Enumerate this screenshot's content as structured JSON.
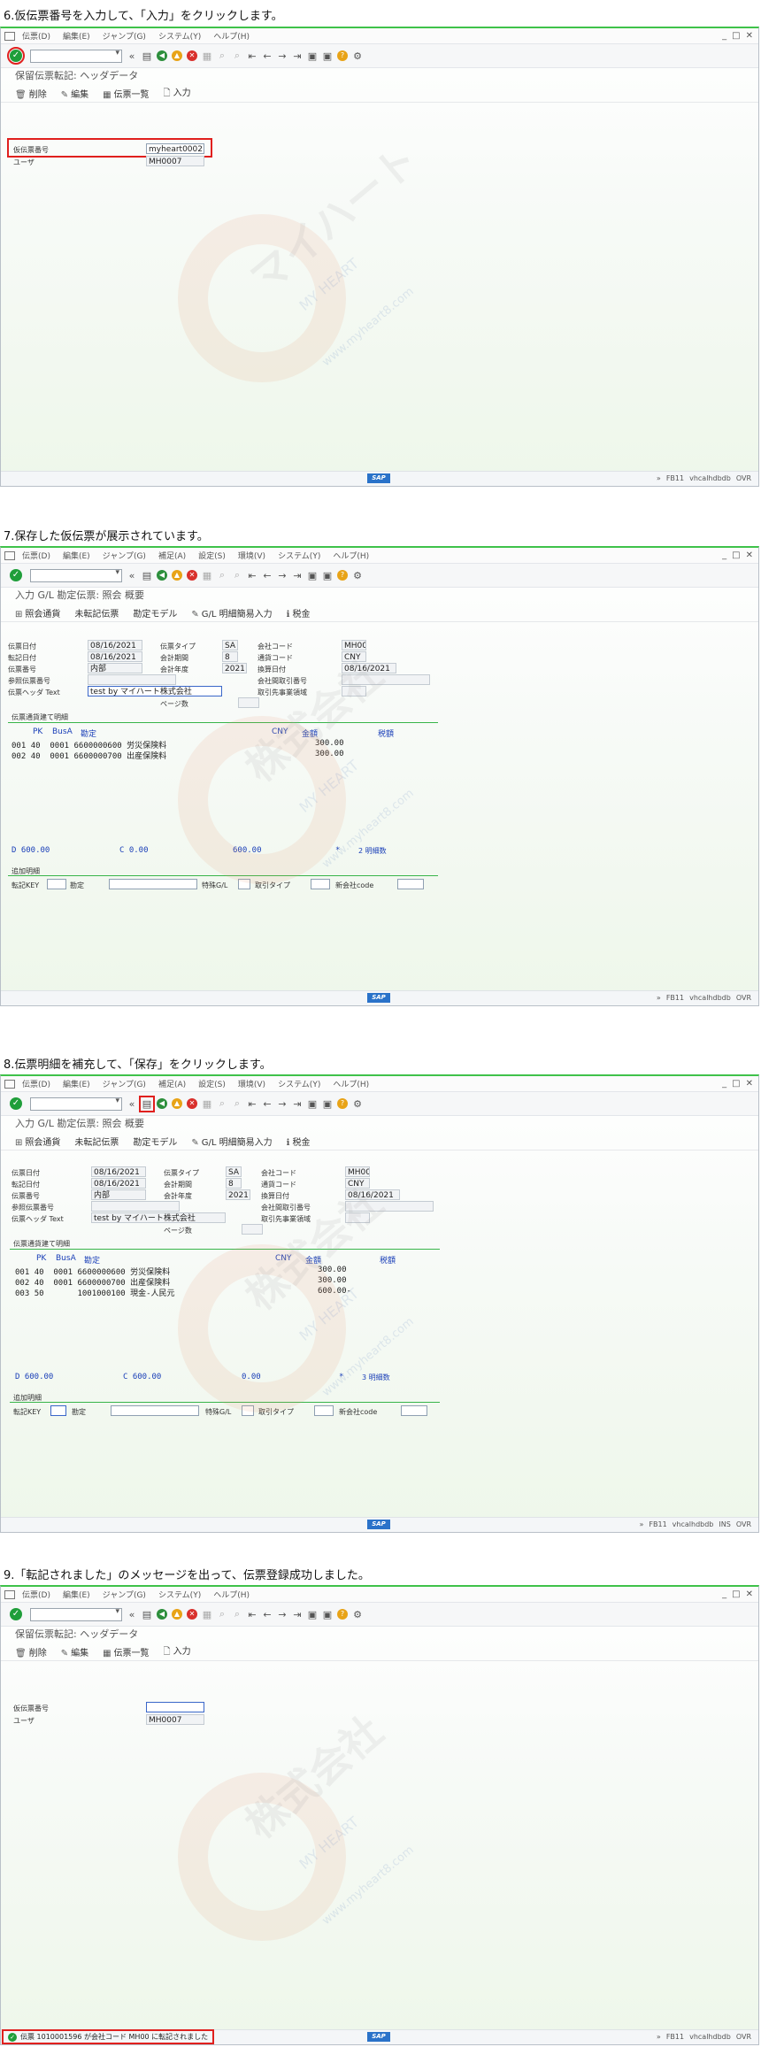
{
  "common": {
    "menu": [
      "伝票(D)",
      "編集(E)",
      "ジャンプ(G)",
      "システム(Y)",
      "ヘルプ(H)"
    ],
    "menu_ext": [
      "伝票(D)",
      "編集(E)",
      "ジャンプ(G)",
      "補足(A)",
      "設定(S)",
      "環境(V)",
      "システム(Y)",
      "ヘルプ(H)"
    ],
    "ok_glyph": "✓",
    "status_right": [
      "»",
      "FB11",
      "vhcalhdbdb",
      "OVR"
    ],
    "status_right_ins": [
      "»",
      "FB11",
      "vhcalhdbdb",
      "INS"
    ],
    "sap_logo": "SAP",
    "watermark": {
      "line1": "マイハート",
      "line2": "株式会社",
      "line3": "MY HEART",
      "line4": "www.myheart8.com"
    }
  },
  "step6": {
    "title": "6.仮伝票番号を入力して、「入力」をクリックします。",
    "app_title": "保留伝票転記: ヘッダデータ",
    "actions": [
      "削除",
      "編集",
      "伝票一覧",
      "入力"
    ],
    "fields": [
      {
        "label": "仮伝票番号",
        "value": "myheart0002"
      },
      {
        "label": "ユーザ",
        "value": "MH0007"
      }
    ]
  },
  "step7": {
    "title": "7.保存した仮伝票が展示されています。",
    "app_title": "入力 G/L 勘定伝票: 照会 概要",
    "actions": [
      "照会通貨",
      "未転記伝票",
      "勘定モデル",
      "G/L 明細簡易入力",
      "税金"
    ],
    "header": {
      "doc_date_label": "伝票日付",
      "doc_date": "08/16/2021",
      "doc_type_label": "伝票タイプ",
      "doc_type": "SA",
      "company_label": "会社コード",
      "company": "MH00",
      "post_date_label": "転記日付",
      "post_date": "08/16/2021",
      "period_label": "会計期間",
      "period": "8",
      "currency_label": "通貨コード",
      "currency": "CNY",
      "doc_no_label": "伝票番号",
      "doc_no": "内部",
      "fy_label": "会計年度",
      "fy": "2021",
      "trans_date_label": "換算日付",
      "trans_date": "08/16/2021",
      "ref_label": "参照伝票番号",
      "ref": "",
      "ic_label": "会社間取引番号",
      "ic": "",
      "text_label": "伝票ヘッダ Text",
      "text": "test by マイハート株式会社",
      "partner_label": "取引先事業領域",
      "partner": "",
      "pages_label": "ページ数",
      "pages": ""
    },
    "items_title": "伝票通貨建て明細",
    "cols": [
      "PK",
      "BusA",
      "勘定",
      "CNY",
      "金額",
      "税額"
    ],
    "items": [
      {
        "pos": "001",
        "pk": "40",
        "busa": "0001",
        "acct": "6600000600",
        "name": "労災保険料",
        "amount": "300.00"
      },
      {
        "pos": "002",
        "pk": "40",
        "busa": "0001",
        "acct": "6600000700",
        "name": "出産保険料",
        "amount": "300.00"
      }
    ],
    "totals": {
      "d": "D 600.00",
      "c": "C 0.00",
      "bal": "600.00",
      "count": "2 明細数",
      "star": "*"
    },
    "addl_title": "追加明細",
    "addl": [
      "転記KEY",
      "勘定",
      "特殊G/L",
      "取引タイプ",
      "新会社code"
    ]
  },
  "step8": {
    "title": "8.伝票明細を補充して、「保存」をクリックします。",
    "app_title": "入力 G/L 勘定伝票: 照会 概要",
    "actions": [
      "照会通貨",
      "未転記伝票",
      "勘定モデル",
      "G/L 明細簡易入力",
      "税金"
    ],
    "header": {
      "doc_date": "08/16/2021",
      "doc_type": "SA",
      "company": "MH00",
      "post_date": "08/16/2021",
      "period": "8",
      "currency": "CNY",
      "doc_no": "内部",
      "fy": "2021",
      "trans_date": "08/16/2021",
      "text": "test by マイハート株式会社"
    },
    "items": [
      {
        "pos": "001",
        "pk": "40",
        "busa": "0001",
        "acct": "6600000600",
        "name": "労災保険料",
        "amount": "300.00"
      },
      {
        "pos": "002",
        "pk": "40",
        "busa": "0001",
        "acct": "6600000700",
        "name": "出産保険料",
        "amount": "300.00"
      },
      {
        "pos": "003",
        "pk": "50",
        "busa": "",
        "acct": "1001000100",
        "name": "現金-人民元",
        "amount": "600.00-"
      }
    ],
    "totals": {
      "d": "D 600.00",
      "c": "C 600.00",
      "bal": "0.00",
      "count": "3 明細数",
      "star": "*"
    },
    "addl_acct": "勘定"
  },
  "step9": {
    "title": "9.「転記されました」のメッセージを出って、伝票登録成功しました。",
    "app_title": "保留伝票転記: ヘッダデータ",
    "actions": [
      "削除",
      "編集",
      "伝票一覧",
      "入力"
    ],
    "fields": [
      {
        "label": "仮伝票番号",
        "value": ""
      },
      {
        "label": "ユーザ",
        "value": "MH0007"
      }
    ],
    "message": "伝票 1010001596 が会社コード MH00 に転記されました"
  }
}
